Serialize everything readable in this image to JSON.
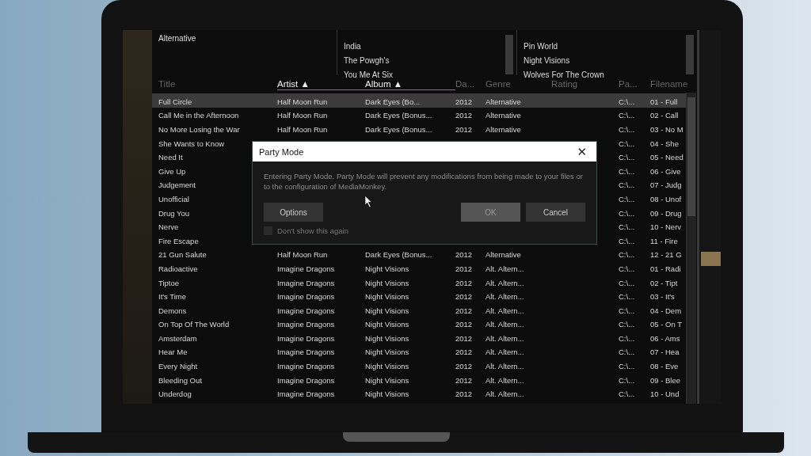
{
  "filter_panes": {
    "genres": [
      "Alternative"
    ],
    "artists": [
      "India",
      "The Powgh's",
      "You Me At Six"
    ],
    "albums": [
      "Pin World",
      "Night Visions",
      "Wolves For The Crown"
    ]
  },
  "table": {
    "columns": [
      {
        "label": "Title",
        "sorted": false
      },
      {
        "label": "Artist ▲",
        "sorted": true
      },
      {
        "label": "Album ▲",
        "sorted": true
      },
      {
        "label": "Da...",
        "sorted": false
      },
      {
        "label": "Genre",
        "sorted": false
      },
      {
        "label": "Rating",
        "sorted": false
      },
      {
        "label": "Pa...",
        "sorted": false
      },
      {
        "label": "Filename",
        "sorted": false
      }
    ],
    "rows": [
      {
        "title": "Full Circle",
        "artist": "Half Moon Run",
        "album": "Dark Eyes (Bo...",
        "date": "2012",
        "genre": "Alternative",
        "path": "C:\\...",
        "filename": "01 - Full",
        "selected": true
      },
      {
        "title": "Call Me in the Afternoon",
        "artist": "Half Moon Run",
        "album": "Dark Eyes (Bonus...",
        "date": "2012",
        "genre": "Alternative",
        "path": "C:\\...",
        "filename": "02 - Call",
        "selected": false
      },
      {
        "title": "No More Losing the War",
        "artist": "Half Moon Run",
        "album": "Dark Eyes (Bonus...",
        "date": "2012",
        "genre": "Alternative",
        "path": "C:\\...",
        "filename": "03 - No M",
        "selected": false
      },
      {
        "title": "She Wants to Know",
        "path": "C:\\...",
        "filename": "04 - She",
        "selected": false
      },
      {
        "title": "Need It",
        "path": "C:\\...",
        "filename": "05 - Need",
        "selected": false
      },
      {
        "title": "Give Up",
        "path": "C:\\...",
        "filename": "06 - Give",
        "selected": false
      },
      {
        "title": "Judgement",
        "path": "C:\\...",
        "filename": "07 - Judg",
        "selected": false
      },
      {
        "title": "Unofficial",
        "path": "C:\\...",
        "filename": "08 - Unof",
        "selected": false
      },
      {
        "title": "Drug You",
        "path": "C:\\...",
        "filename": "09 - Drug",
        "selected": false
      },
      {
        "title": "Nerve",
        "path": "C:\\...",
        "filename": "10 - Nerv",
        "selected": false
      },
      {
        "title": "Fire Escape",
        "path": "C:\\...",
        "filename": "11 - Fire",
        "selected": false
      },
      {
        "title": "21 Gun Salute",
        "artist": "Half Moon Run",
        "album": "Dark Eyes (Bonus...",
        "date": "2012",
        "genre": "Alternative",
        "path": "C:\\...",
        "filename": "12 - 21 G",
        "selected": false
      },
      {
        "title": "Radioactive",
        "artist": "Imagine Dragons",
        "album": "Night Visions",
        "date": "2012",
        "genre": "Alt. Altern...",
        "path": "C:\\...",
        "filename": "01 - Radi",
        "selected": false
      },
      {
        "title": "Tiptoe",
        "artist": "Imagine Dragons",
        "album": "Night Visions",
        "date": "2012",
        "genre": "Alt. Altern...",
        "path": "C:\\...",
        "filename": "02 - Tipt",
        "selected": false
      },
      {
        "title": "It's Time",
        "artist": "Imagine Dragons",
        "album": "Night Visions",
        "date": "2012",
        "genre": "Alt. Altern...",
        "path": "C:\\...",
        "filename": "03 - It's",
        "selected": false
      },
      {
        "title": "Demons",
        "artist": "Imagine Dragons",
        "album": "Night Visions",
        "date": "2012",
        "genre": "Alt. Altern...",
        "path": "C:\\...",
        "filename": "04 - Dem",
        "selected": false
      },
      {
        "title": "On Top Of The World",
        "artist": "Imagine Dragons",
        "album": "Night Visions",
        "date": "2012",
        "genre": "Alt. Altern...",
        "path": "C:\\...",
        "filename": "05 - On T",
        "selected": false
      },
      {
        "title": "Amsterdam",
        "artist": "Imagine Dragons",
        "album": "Night Visions",
        "date": "2012",
        "genre": "Alt. Altern...",
        "path": "C:\\...",
        "filename": "06 - Ams",
        "selected": false
      },
      {
        "title": "Hear Me",
        "artist": "Imagine Dragons",
        "album": "Night Visions",
        "date": "2012",
        "genre": "Alt. Altern...",
        "path": "C:\\...",
        "filename": "07 - Hea",
        "selected": false
      },
      {
        "title": "Every Night",
        "artist": "Imagine Dragons",
        "album": "Night Visions",
        "date": "2012",
        "genre": "Alt. Altern...",
        "path": "C:\\...",
        "filename": "08 - Eve",
        "selected": false
      },
      {
        "title": "Bleeding Out",
        "artist": "Imagine Dragons",
        "album": "Night Visions",
        "date": "2012",
        "genre": "Alt. Altern...",
        "path": "C:\\...",
        "filename": "09 - Blee",
        "selected": false
      },
      {
        "title": "Underdog",
        "artist": "Imagine Dragons",
        "album": "Night Visions",
        "date": "2012",
        "genre": "Alt. Altern...",
        "path": "C:\\...",
        "filename": "10 - Und",
        "selected": false
      }
    ]
  },
  "dialog": {
    "title": "Party Mode",
    "close": "✕",
    "message": "Entering Party Mode. Party Mode will prevent any modifications from being made to your files or to the configuration of MediaMonkey.",
    "options_button": "Options",
    "ok_button": "OK",
    "cancel_button": "Cancel",
    "checkbox": {
      "label": "Don't show this again",
      "checked": false
    }
  }
}
